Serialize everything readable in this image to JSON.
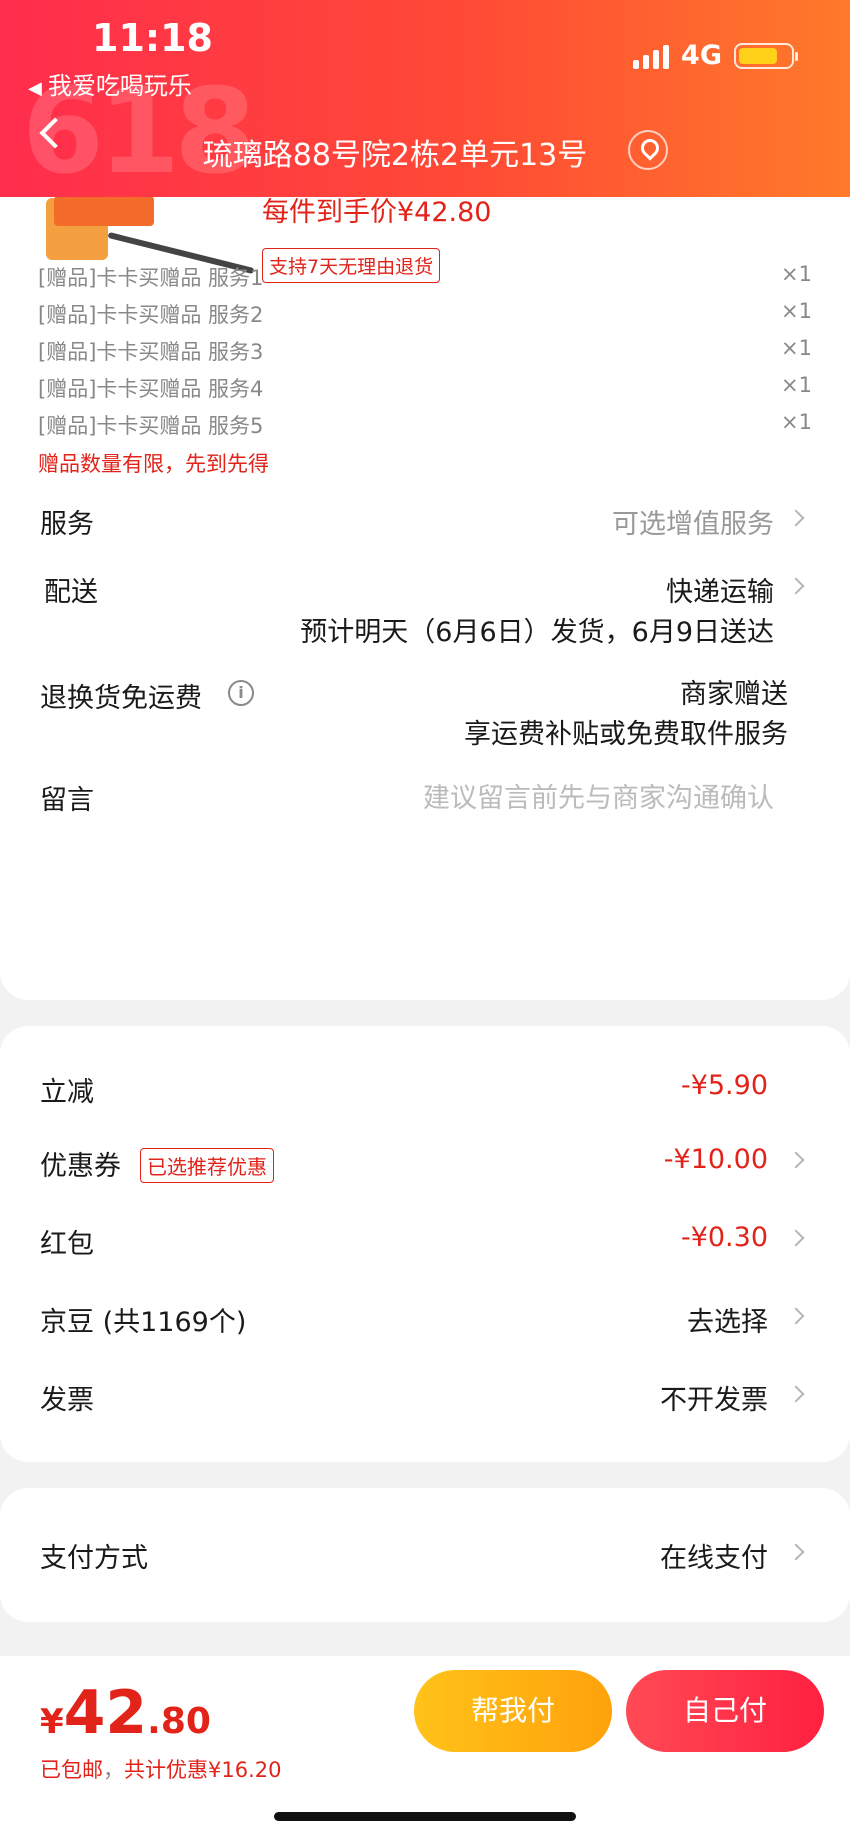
{
  "status_bar": {
    "time": "11:18",
    "back_app": "我爱吃喝玩乐",
    "network": "4G",
    "battery_level": 0.75,
    "battery_color": "#ffd21a"
  },
  "header": {
    "address": "琉璃路88号院2栋2单元13号",
    "decoration": "618",
    "background": "#ff3b3b"
  },
  "product": {
    "price_each": "每件到手价¥42.80",
    "return_policy": "支持7天无理由退货"
  },
  "gifts": [
    {
      "name": "[赠品]卡卡买赠品 服务1",
      "qty": "×1"
    },
    {
      "name": "[赠品]卡卡买赠品 服务2",
      "qty": "×1"
    },
    {
      "name": "[赠品]卡卡买赠品 服务3",
      "qty": "×1"
    },
    {
      "name": "[赠品]卡卡买赠品 服务4",
      "qty": "×1"
    },
    {
      "name": "[赠品]卡卡买赠品 服务5",
      "qty": "×1"
    }
  ],
  "gift_note": "赠品数量有限，先到先得",
  "order_rows": {
    "service": {
      "label": "服务",
      "value": "可选增值服务"
    },
    "delivery": {
      "label": "配送",
      "value": "快递运输",
      "detail": "预计明天（6月6日）发货，6月9日送达"
    },
    "free_return": {
      "label": "退换货免运费",
      "value": "商家赠送",
      "detail": "享运费补贴或免费取件服务"
    },
    "message": {
      "label": "留言",
      "placeholder": "建议留言前先与商家沟通确认"
    }
  },
  "discounts": {
    "instant": {
      "label": "立减",
      "value": "-¥5.90"
    },
    "coupon": {
      "label": "优惠券",
      "badge": "已选推荐优惠",
      "value": "-¥10.00"
    },
    "red_packet": {
      "label": "红包",
      "value": "-¥0.30"
    },
    "jd_beans": {
      "label": "京豆 (共1169个)",
      "value": "去选择"
    },
    "invoice": {
      "label": "发票",
      "value": "不开发票"
    }
  },
  "payment": {
    "label": "支付方式",
    "value": "在线支付"
  },
  "bottom": {
    "currency": "¥",
    "total_int": "42",
    "total_dec": ".80",
    "shipping": "已包邮",
    "separator": "，",
    "savings": "共计优惠¥16.20",
    "help_pay": "帮我付",
    "self_pay": "自己付"
  }
}
